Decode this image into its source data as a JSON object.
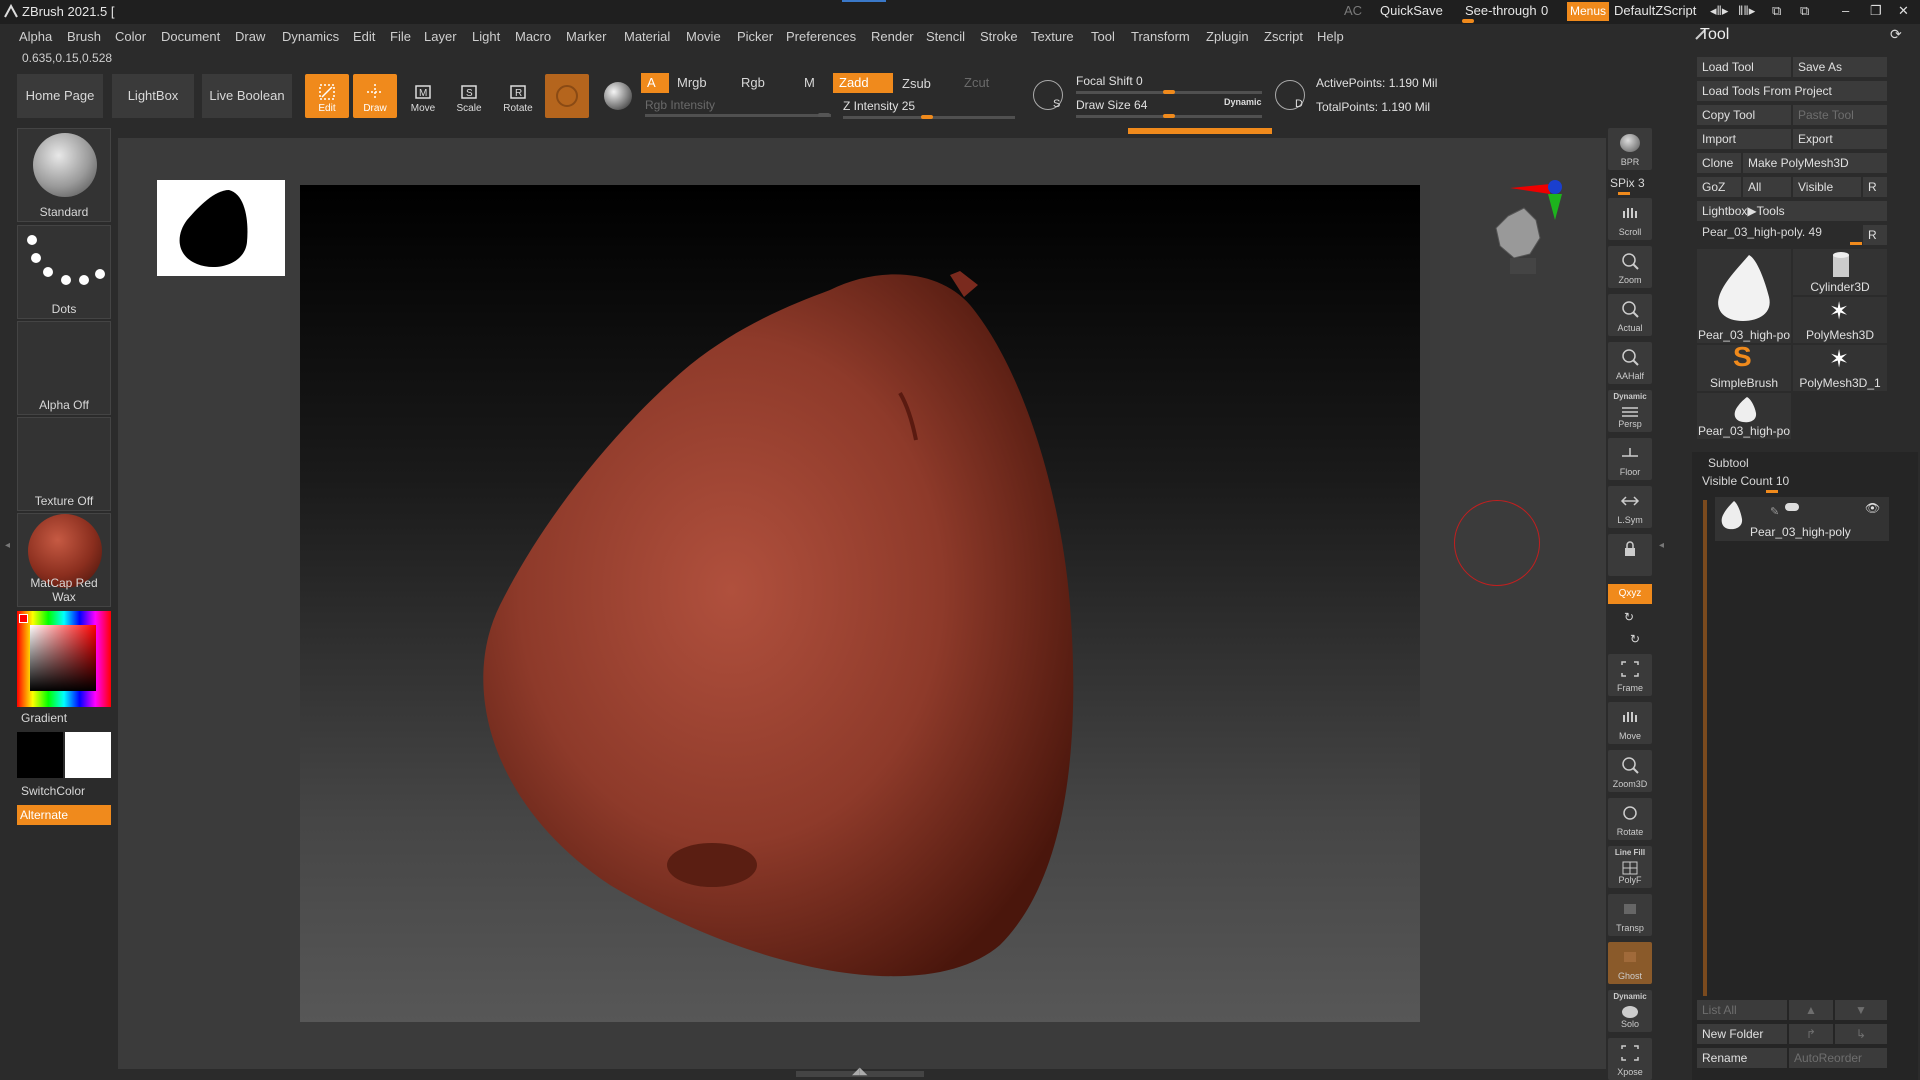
{
  "window": {
    "title": "ZBrush 2021.5 [",
    "ac": "AC",
    "quicksave": "QuickSave",
    "see_through_label": "See-through",
    "see_through_value": "0",
    "menus": "Menus",
    "default_zscript": "DefaultZScript"
  },
  "menubar": [
    "Alpha",
    "Brush",
    "Color",
    "Document",
    "Draw",
    "Dynamics",
    "Edit",
    "File",
    "Layer",
    "Light",
    "Macro",
    "Marker",
    "Material",
    "Movie",
    "Picker",
    "Preferences",
    "Render",
    "Stencil",
    "Stroke",
    "Texture",
    "Tool",
    "Transform",
    "Zplugin",
    "Zscript",
    "Help"
  ],
  "coords": "0.635,0.15,0.528",
  "toolbar": {
    "home_page": "Home Page",
    "lightbox": "LightBox",
    "live_boolean": "Live Boolean",
    "edit": "Edit",
    "draw": "Draw",
    "move": "Move",
    "scale": "Scale",
    "rotate": "Rotate",
    "a": "A",
    "mrgb": "Mrgb",
    "rgb": "Rgb",
    "m": "M",
    "zadd": "Zadd",
    "zsub": "Zsub",
    "zcut": "Zcut",
    "rgb_intensity": "Rgb Intensity",
    "z_intensity": "Z Intensity 25",
    "focal_shift": "Focal Shift 0",
    "draw_size": "Draw Size 64",
    "dynamic": "Dynamic",
    "active_points": "ActivePoints: 1.190 Mil",
    "total_points": "TotalPoints: 1.190 Mil",
    "s_label": "S",
    "d_label": "D"
  },
  "left_shelf": {
    "brush": "Standard",
    "stroke": "Dots",
    "alpha": "Alpha Off",
    "texture": "Texture Off",
    "material": "MatCap Red Wax",
    "gradient": "Gradient",
    "switch_color": "SwitchColor",
    "alternate": "Alternate"
  },
  "right_shelf": [
    {
      "name": "bpr",
      "label": "BPR"
    },
    {
      "name": "spix",
      "label": "SPix 3"
    },
    {
      "name": "scroll",
      "label": "Scroll"
    },
    {
      "name": "zoom",
      "label": "Zoom"
    },
    {
      "name": "actual",
      "label": "Actual"
    },
    {
      "name": "aahalf",
      "label": "AAHalf"
    },
    {
      "name": "persp",
      "label": "Persp"
    },
    {
      "name": "persp-top",
      "label": "Dynamic"
    },
    {
      "name": "floor",
      "label": "Floor"
    },
    {
      "name": "lsym",
      "label": "L.Sym"
    },
    {
      "name": "xyz",
      "label": "Qxyz"
    },
    {
      "name": "frame",
      "label": "Frame"
    },
    {
      "name": "move",
      "label": "Move"
    },
    {
      "name": "zoom3d",
      "label": "Zoom3D"
    },
    {
      "name": "rotate",
      "label": "Rotate"
    },
    {
      "name": "linefill-top",
      "label": "Line Fill"
    },
    {
      "name": "polyf",
      "label": "PolyF"
    },
    {
      "name": "transp",
      "label": "Transp"
    },
    {
      "name": "ghost",
      "label": "Ghost"
    },
    {
      "name": "solo-top",
      "label": "Dynamic"
    },
    {
      "name": "solo",
      "label": "Solo"
    },
    {
      "name": "xpose",
      "label": "Xpose"
    }
  ],
  "tool_panel": {
    "title": "Tool",
    "load_tool": "Load Tool",
    "save_as": "Save As",
    "load_from_project": "Load Tools From Project",
    "copy_tool": "Copy Tool",
    "paste_tool": "Paste Tool",
    "import": "Import",
    "export": "Export",
    "clone": "Clone",
    "make_polymesh": "Make PolyMesh3D",
    "goz": "GoZ",
    "all": "All",
    "visible": "Visible",
    "r": "R",
    "lightbox_tools": "Lightbox▶Tools",
    "current_tool": "Pear_03_high-poly. 49",
    "thumbs": [
      "Pear_03_high-po",
      "Cylinder3D",
      "Pear_03_high-po",
      "PolyMesh3D",
      "SimpleBrush",
      "PolyMesh3D_1",
      "Pear_03_high-po"
    ],
    "subtool_title": "Subtool",
    "visible_count": "Visible Count 10",
    "subtool_name": "Pear_03_high-poly",
    "list_all": "List All",
    "new_folder": "New Folder",
    "rename": "Rename",
    "auto_reorder": "AutoReorder"
  },
  "colors": {
    "accent": "#f08a1c",
    "pear": "#9a4030"
  }
}
